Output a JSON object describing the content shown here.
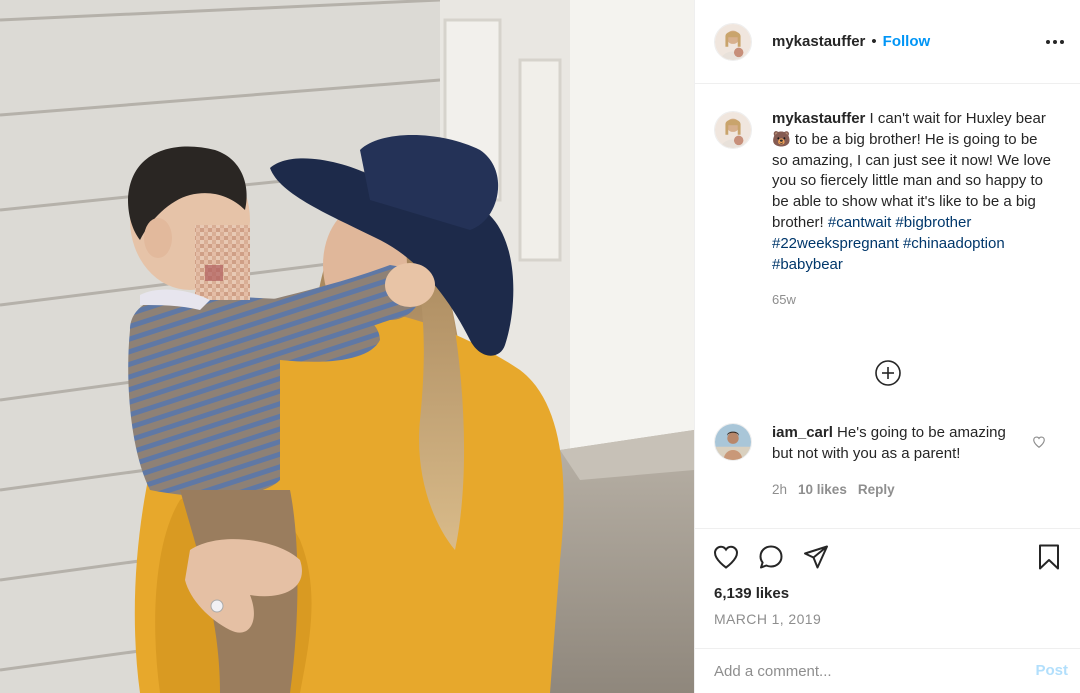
{
  "post": {
    "image_alt": "Woman in yellow sweater and black hat holding a toddler",
    "author": {
      "username": "mykastauffer",
      "separator": "•",
      "follow_label": "Follow",
      "avatar_icon": "profile-avatar-icon"
    },
    "more_icon": "more-options-icon",
    "caption": {
      "username": "mykastauffer",
      "text": " I can't wait for Huxley bear 🐻 to be a big brother! He is going to be so amazing, I can just see it now! We love you so fiercely little man and so happy to be able to show what it's like to be a big brother! ",
      "hashtags": [
        "#cantwait",
        "#bigbrother",
        "#22weekspregnant",
        "#chinaadoption",
        "#babybear"
      ],
      "time": "65w"
    },
    "load_more_icon": "plus-circle-icon",
    "comments": [
      {
        "username": "iam_carl",
        "text": " He's going to be amazing but not with you as a parent!",
        "time": "2h",
        "likes": "10 likes",
        "reply_label": "Reply"
      }
    ],
    "actions": {
      "like_icon": "heart-icon",
      "comment_icon": "comment-icon",
      "share_icon": "share-icon",
      "save_icon": "bookmark-icon"
    },
    "likes": "6,139 likes",
    "date": "MARCH 1, 2019",
    "add_comment": {
      "placeholder": "Add a comment...",
      "post_label": "Post"
    },
    "colors": {
      "link_blue": "#0095f6",
      "hashtag": "#00376b",
      "muted": "#8e8e8e",
      "disabled_post": "#b2dffc"
    }
  }
}
